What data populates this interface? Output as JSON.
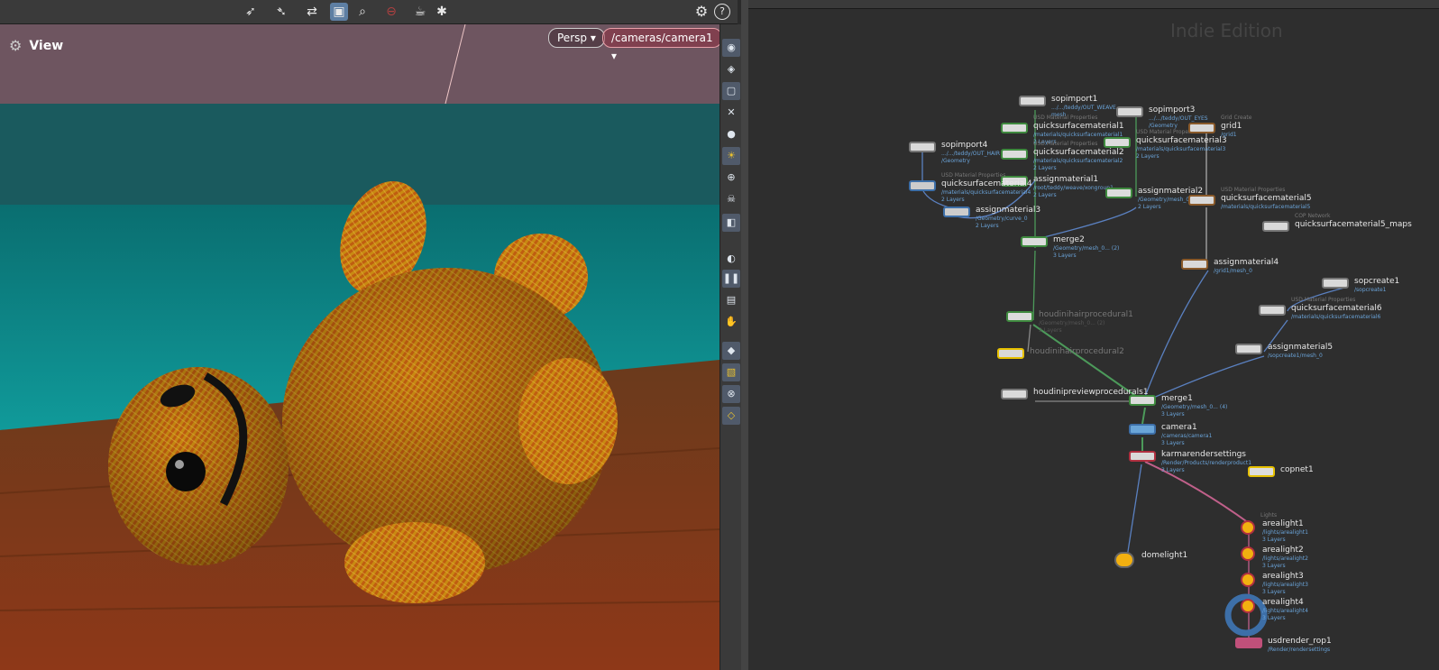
{
  "toolbar": {
    "icons": [
      "select-arrow-icon",
      "select-arrow-icon",
      "transform-icon",
      "camera-view-icon",
      "zoom-icon",
      "no-entry-icon",
      "render-icon",
      "snapshot-icon",
      "gear-icon",
      "help-icon"
    ],
    "help_glyph": "?"
  },
  "viewport": {
    "title": "View",
    "persp_label": "Persp",
    "camera_label": "/cameras/camera1"
  },
  "network": {
    "edition_text": "Indie Edition",
    "nodes": [
      {
        "name": "sopimport1",
        "subs": [
          ".../.../teddy/OUT_WEAVE",
          "mesh"
        ],
        "comment": ""
      },
      {
        "name": "quicksurfacematerial1",
        "subs": [
          "/materials/quicksurfacematerial1",
          "2 Layers"
        ],
        "comment": "USD Material Properties"
      },
      {
        "name": "quicksurfacematerial2",
        "subs": [
          "/materials/quicksurfacematerial2",
          "2 Layers"
        ],
        "comment": "USD Material Properties"
      },
      {
        "name": "assignmaterial1",
        "subs": [
          "/root/teddy/weave/xongroup1",
          "2 Layers"
        ],
        "comment": ""
      },
      {
        "name": "sopimport4",
        "subs": [
          ".../.../teddy/OUT_HAIR",
          "/Geometry"
        ],
        "comment": ""
      },
      {
        "name": "quicksurfacematerial4",
        "subs": [
          "/materials/quicksurfacematerial4",
          "2 Layers"
        ],
        "comment": "USD Material Properties"
      },
      {
        "name": "assignmaterial3",
        "subs": [
          "/Geometry/curve_0",
          "2 Layers"
        ],
        "comment": ""
      },
      {
        "name": "sopimport3",
        "subs": [
          ".../.../teddy/OUT_EYES",
          "/Geometry"
        ],
        "comment": ""
      },
      {
        "name": "quicksurfacematerial3",
        "subs": [
          "/materials/quicksurfacematerial3",
          "2 Layers"
        ],
        "comment": "USD Material Properties"
      },
      {
        "name": "grid1",
        "subs": [
          "/grid1"
        ],
        "comment": "Grid Create"
      },
      {
        "name": "assignmaterial2",
        "subs": [
          "/Geometry/mesh_0",
          "2 Layers"
        ],
        "comment": ""
      },
      {
        "name": "quicksurfacematerial5",
        "subs": [
          "/materials/quicksurfacematerial5"
        ],
        "comment": "USD Material Properties"
      },
      {
        "name": "quicksurfacematerial5_maps",
        "subs": [],
        "comment": "COP Network"
      },
      {
        "name": "merge2",
        "subs": [
          "/Geometry/mesh_0... (2)",
          "3 Layers"
        ],
        "comment": ""
      },
      {
        "name": "assignmaterial4",
        "subs": [
          "/grid1/mesh_0"
        ],
        "comment": ""
      },
      {
        "name": "sopcreate1",
        "subs": [
          "/sopcreate1"
        ],
        "comment": ""
      },
      {
        "name": "quicksurfacematerial6",
        "subs": [
          "/materials/quicksurfacematerial6"
        ],
        "comment": "USD Material Properties"
      },
      {
        "name": "houdinihairprocedural1",
        "subs": [
          "/Geometry/mesh_0... (2)",
          "3 Layers"
        ],
        "comment": ""
      },
      {
        "name": "houdinihairprocedural2",
        "subs": [],
        "comment": ""
      },
      {
        "name": "assignmaterial5",
        "subs": [
          "/sopcreate1/mesh_0"
        ],
        "comment": ""
      },
      {
        "name": "houdinipreviewprocedurals1",
        "subs": [],
        "comment": ""
      },
      {
        "name": "merge1",
        "subs": [
          "/Geometry/mesh_0... (4)",
          "3 Layers"
        ],
        "comment": ""
      },
      {
        "name": "camera1",
        "subs": [
          "/cameras/camera1",
          "3 Layers"
        ],
        "comment": ""
      },
      {
        "name": "karmarendersettings",
        "subs": [
          "/Render/Products/renderproduct1",
          "3 Layers"
        ],
        "comment": ""
      },
      {
        "name": "copnet1",
        "subs": [],
        "comment": ""
      },
      {
        "name": "domelight1",
        "subs": [],
        "comment": ""
      },
      {
        "name": "arealight1",
        "subs": [
          "/lights/arealight1",
          "3 Layers"
        ],
        "comment": "Lights"
      },
      {
        "name": "arealight2",
        "subs": [
          "/lights/arealight2",
          "3 Layers"
        ],
        "comment": ""
      },
      {
        "name": "arealight3",
        "subs": [
          "/lights/arealight3",
          "3 Layers"
        ],
        "comment": ""
      },
      {
        "name": "arealight4",
        "subs": [
          "/lights/arealight4",
          "3 Layers"
        ],
        "comment": ""
      },
      {
        "name": "usdrender_rop1",
        "subs": [
          "/Render/rendersettings"
        ],
        "comment": ""
      }
    ]
  },
  "colors": {
    "viewport_wall_top": "#6e5560",
    "viewport_wall_teal": "#0f8c8c",
    "floor": "#8a3f18",
    "bear_knit": "#c98a12",
    "accent_selected": "#5e7fa3",
    "camera_pill_border": "#e8a0a8"
  }
}
